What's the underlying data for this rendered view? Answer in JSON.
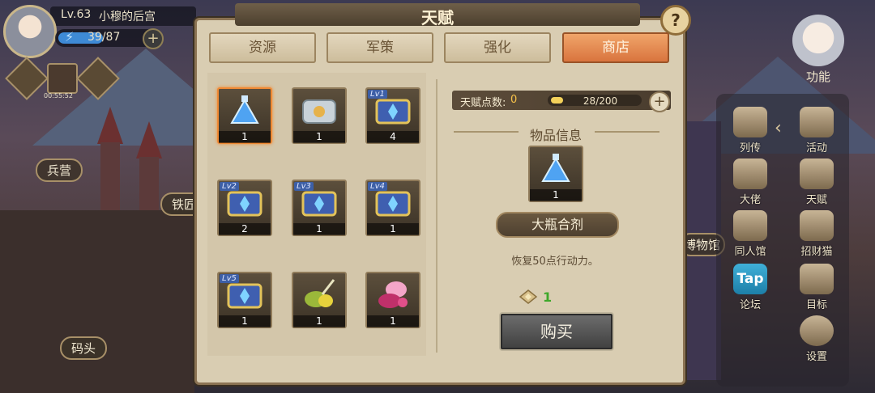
{
  "hud": {
    "level": "Lv.63",
    "player_name": "小穆的后宫",
    "energy": "39/87",
    "energy_fraction": 0.45,
    "icon_caption": "00:55:52"
  },
  "town_labels": [
    "兵营",
    "铁匠",
    "博物馆",
    "码头"
  ],
  "right_panel": {
    "function_label": "功能",
    "items": [
      {
        "label": "列传",
        "icon": "scroll-icon"
      },
      {
        "label": "活动",
        "icon": "star-badge-icon"
      },
      {
        "label": "大佬",
        "icon": "boss-icon"
      },
      {
        "label": "天赋",
        "icon": "talent-icon"
      },
      {
        "label": "同人馆",
        "icon": "gallery-icon"
      },
      {
        "label": "招财猫",
        "icon": "lucky-cat-icon"
      },
      {
        "label": "论坛",
        "icon": "tap-icon"
      },
      {
        "label": "目标",
        "icon": "target-icon"
      },
      {
        "label": "设置",
        "icon": "gear-icon"
      }
    ],
    "tap_text": "Tap"
  },
  "modal": {
    "title": "天赋",
    "help": "?",
    "tabs": [
      {
        "label": "资源",
        "active": false
      },
      {
        "label": "军策",
        "active": false
      },
      {
        "label": "强化",
        "active": false
      },
      {
        "label": "商店",
        "active": true
      }
    ],
    "items": [
      {
        "icon": "blue-potion-icon",
        "count": "1",
        "badge": "",
        "selected": true
      },
      {
        "icon": "silver-chest-icon",
        "count": "1",
        "badge": "",
        "selected": false
      },
      {
        "icon": "treasure-chest-icon",
        "count": "4",
        "badge": "Lv1",
        "selected": false
      },
      {
        "icon": "treasure-chest-icon",
        "count": "2",
        "badge": "Lv2",
        "selected": false
      },
      {
        "icon": "treasure-chest-icon",
        "count": "1",
        "badge": "Lv3",
        "selected": false
      },
      {
        "icon": "treasure-chest-icon",
        "count": "1",
        "badge": "Lv4",
        "selected": false
      },
      {
        "icon": "treasure-chest-icon",
        "count": "1",
        "badge": "Lv5",
        "selected": false
      },
      {
        "icon": "green-food-icon",
        "count": "1",
        "badge": "",
        "selected": false
      },
      {
        "icon": "pink-food-icon",
        "count": "1",
        "badge": "",
        "selected": false
      }
    ],
    "talent_points_label": "天赋点数:",
    "talent_points_value": "0",
    "progress_text": "28/200",
    "progress_fraction": 0.14,
    "info_header": "物品信息",
    "selected_item": {
      "count": "1",
      "name": "大瓶合剂",
      "description": "恢复50点行动力。"
    },
    "price": "1",
    "buy_label": "购买"
  },
  "colors": {
    "accent_tab": "#d9743e",
    "price_green": "#3ea82a",
    "selected_border": "#f08a34"
  }
}
